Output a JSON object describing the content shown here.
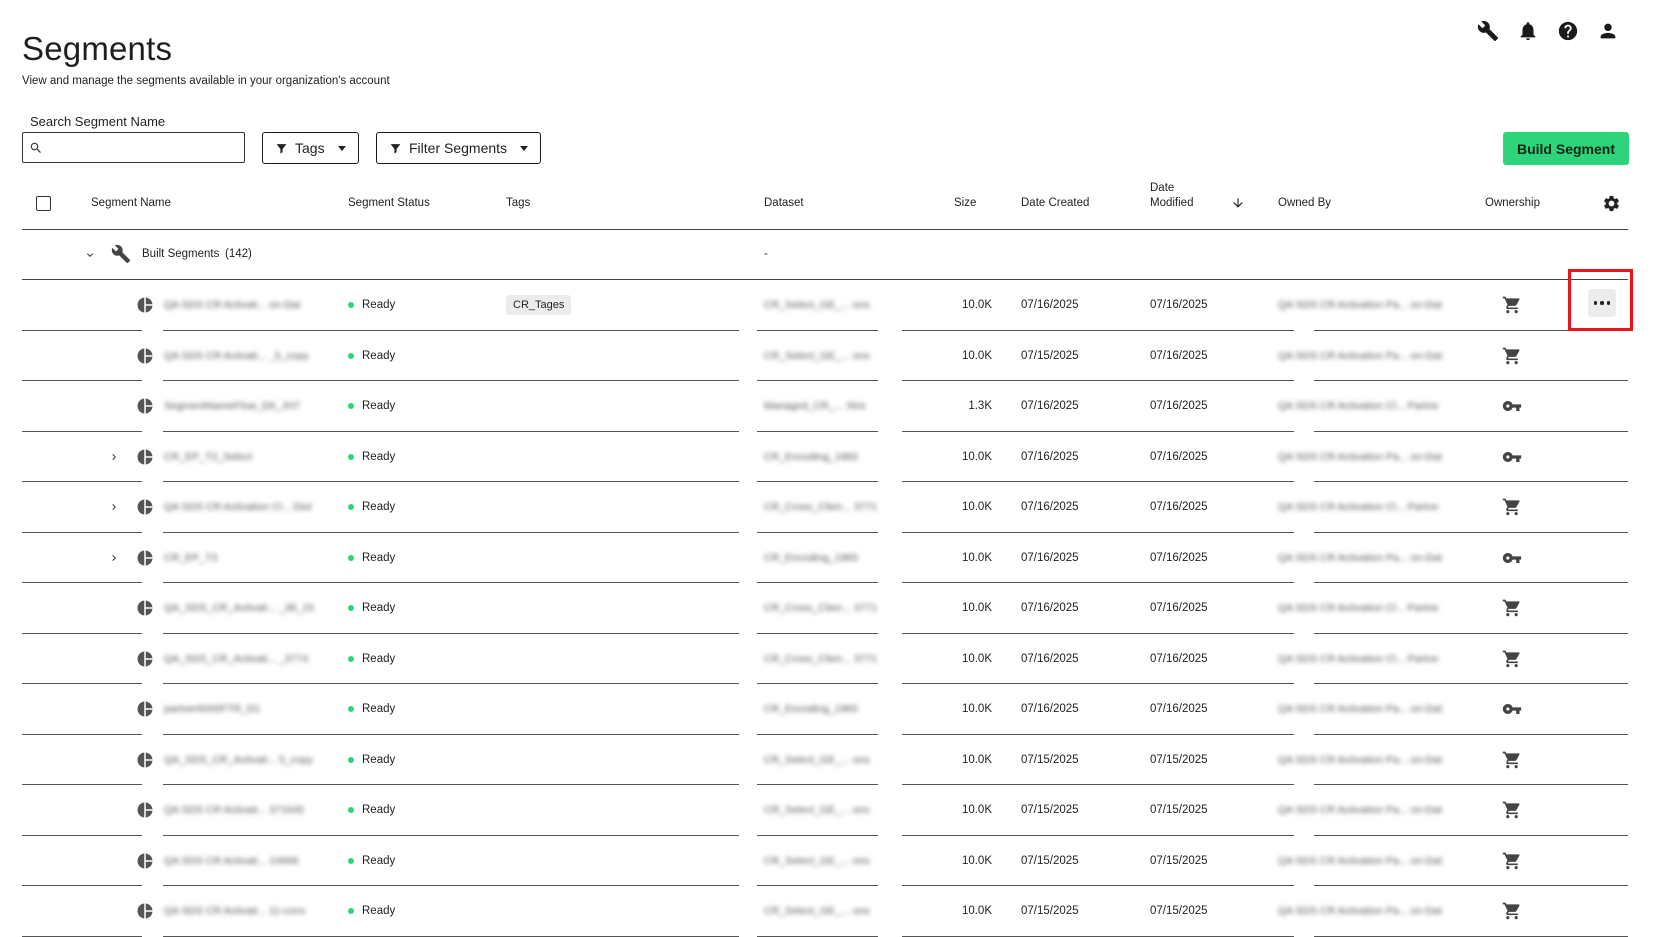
{
  "header": {
    "title": "Segments",
    "subtitle": "View and manage the segments available in your organization's account",
    "icons": [
      "wrench-icon",
      "bell-icon",
      "help-icon",
      "user-icon"
    ]
  },
  "toolbar": {
    "search_label": "Search Segment Name",
    "search_value": "",
    "tags_label": "Tags",
    "filter_label": "Filter Segments",
    "build_label": "Build Segment"
  },
  "colors": {
    "accent": "#2ed47a",
    "highlight": "#e8141c",
    "status_ready": "#2ed47a"
  },
  "table": {
    "columns": {
      "name": "Segment Name",
      "status": "Segment Status",
      "tags": "Tags",
      "dataset": "Dataset",
      "size": "Size",
      "created": "Date Created",
      "modified": "Date Modified",
      "owner": "Owned By",
      "ownership": "Ownership"
    },
    "group": {
      "label": "Built Segments",
      "count": "(142)",
      "dataset": "-"
    },
    "rows": [
      {
        "name": "QA SDS CR Activati... on-Dat",
        "expand": false,
        "status": "Ready",
        "tag": "CR_Tages",
        "dataset": "CR_Select_GE_... ons",
        "size": "10.0K",
        "created": "07/16/2025",
        "modified": "07/16/2025",
        "owner": "QA SDS CR Activation Pa... on-Dat",
        "ownership": "cart"
      },
      {
        "name": "QA SDS CR Activati... _5_copy",
        "expand": false,
        "status": "Ready",
        "tag": "",
        "dataset": "CR_Select_GE_... ons",
        "size": "10.0K",
        "created": "07/15/2025",
        "modified": "07/16/2025",
        "owner": "QA SDS CR Activation Pa... on-Dat",
        "ownership": "cart"
      },
      {
        "name": "SegmentNameFlow_D6_JH7",
        "expand": false,
        "status": "Ready",
        "tag": "",
        "dataset": "Managed_CR_... Stre",
        "size": "1.3K",
        "created": "07/16/2025",
        "modified": "07/16/2025",
        "owner": "QA SDS CR Activation Cl... Partne",
        "ownership": "key"
      },
      {
        "name": "CR_EP_T3_Select",
        "expand": true,
        "status": "Ready",
        "tag": "",
        "dataset": "CR_Encoding_1965",
        "size": "10.0K",
        "created": "07/16/2025",
        "modified": "07/16/2025",
        "owner": "QA SDS CR Activation Pa... on-Dat",
        "ownership": "key"
      },
      {
        "name": "QA SDS CR Activation Cl... Dist",
        "expand": true,
        "status": "Ready",
        "tag": "",
        "dataset": "CR_Cross_Clien... 3771",
        "size": "10.0K",
        "created": "07/16/2025",
        "modified": "07/16/2025",
        "owner": "QA SDS CR Activation Cl... Partne",
        "ownership": "cart"
      },
      {
        "name": "CR_EP_T3",
        "expand": true,
        "status": "Ready",
        "tag": "",
        "dataset": "CR_Encoding_1965",
        "size": "10.0K",
        "created": "07/16/2025",
        "modified": "07/16/2025",
        "owner": "QA SDS CR Activation Pa... on-Dat",
        "ownership": "key"
      },
      {
        "name": "QA_SDS_CR_Activati... _38_15",
        "expand": false,
        "status": "Ready",
        "tag": "",
        "dataset": "CR_Cross_Clien... 3771",
        "size": "10.0K",
        "created": "07/16/2025",
        "modified": "07/16/2025",
        "owner": "QA SDS CR Activation Cl... Partne",
        "ownership": "cart"
      },
      {
        "name": "QA_SDS_CR_Activati... _3774",
        "expand": false,
        "status": "Ready",
        "tag": "",
        "dataset": "CR_Cross_Clien... 3771",
        "size": "10.0K",
        "created": "07/16/2025",
        "modified": "07/16/2025",
        "owner": "QA SDS CR Activation Cl... Partne",
        "ownership": "cart"
      },
      {
        "name": "partner6000FTR_D1",
        "expand": false,
        "status": "Ready",
        "tag": "",
        "dataset": "CR_Encoding_1965",
        "size": "10.0K",
        "created": "07/16/2025",
        "modified": "07/16/2025",
        "owner": "QA SDS CR Activation Pa... on-Dat",
        "ownership": "key"
      },
      {
        "name": "QA_SDS_CR_Activati... 5_copy",
        "expand": false,
        "status": "Ready",
        "tag": "",
        "dataset": "CR_Select_GE_... ons",
        "size": "10.0K",
        "created": "07/15/2025",
        "modified": "07/15/2025",
        "owner": "QA SDS CR Activation Pa... on-Dat",
        "ownership": "cart"
      },
      {
        "name": "QA SDS CR Activati... 371645",
        "expand": false,
        "status": "Ready",
        "tag": "",
        "dataset": "CR_Select_GE_... ons",
        "size": "10.0K",
        "created": "07/15/2025",
        "modified": "07/15/2025",
        "owner": "QA SDS CR Activation Pa... on-Dat",
        "ownership": "cart"
      },
      {
        "name": "QA SDS CR Activati... 10668",
        "expand": false,
        "status": "Ready",
        "tag": "",
        "dataset": "CR_Select_GE_... ons",
        "size": "10.0K",
        "created": "07/15/2025",
        "modified": "07/15/2025",
        "owner": "QA SDS CR Activation Pa... on-Dat",
        "ownership": "cart"
      },
      {
        "name": "QA SDS CR Activati... 11-conv",
        "expand": false,
        "status": "Ready",
        "tag": "",
        "dataset": "CR_Select_GE_... ons",
        "size": "10.0K",
        "created": "07/15/2025",
        "modified": "07/15/2025",
        "owner": "QA SDS CR Activation Pa... on-Dat",
        "ownership": "cart"
      }
    ]
  }
}
